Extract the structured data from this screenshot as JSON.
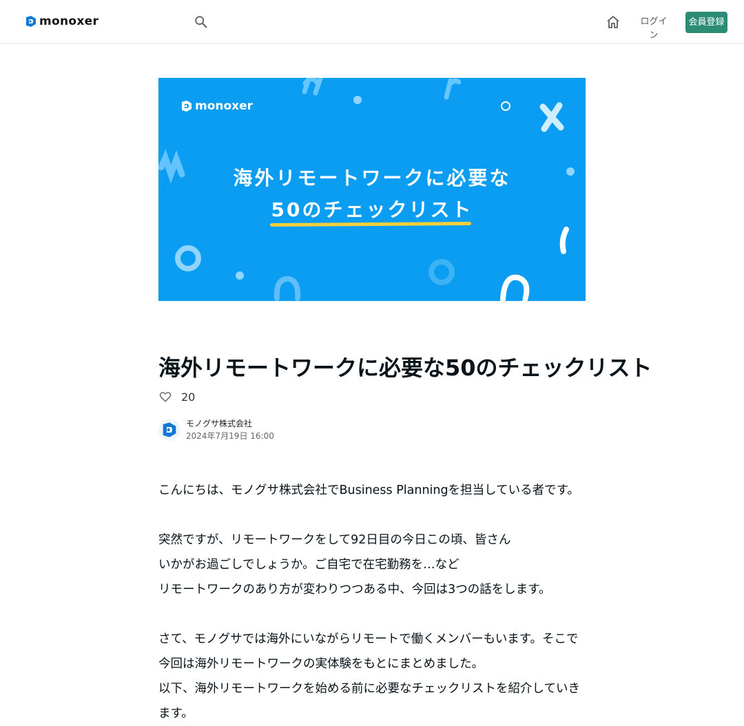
{
  "header": {
    "logo_text": "monoxer",
    "search_icon": "search-icon",
    "home_icon": "home-icon",
    "login_label": "ログイン",
    "signup_label": "会員登録"
  },
  "banner": {
    "logo_text": "monoxer",
    "line1": "海外リモートワークに必要な",
    "line2": "50のチェックリスト",
    "background_color": "#0b9df2",
    "underline_color": "#f3cf3a"
  },
  "article": {
    "title": "海外リモートワークに必要な50のチェックリスト",
    "like_icon": "heart-icon",
    "like_count": "20",
    "author_name": "モノグサ株式会社",
    "date": "2024年7月19日 16:00",
    "paragraphs": [
      "こんにちは、モノグサ株式会社でBusiness Planningを担当している者です。",
      "",
      "突然ですが、リモートワークをして92日目の今日この頃、皆さん",
      "いかがお過ごしでしょうか。ご自宅で在宅勤務を…など",
      "リモートワークのあり方が変わりつつある中、今回は3つの話をします。",
      "",
      "さて、モノグサでは海外にいながらリモートで働くメンバーもいます。そこで今回は海外リモートワークの実体験をもとにまとめました。",
      "以下、海外リモートワークを始める前に必要なチェックリストを紹介していきます。"
    ]
  },
  "colors": {
    "accent_green": "#2d8c75",
    "text_primary": "#08131a"
  }
}
